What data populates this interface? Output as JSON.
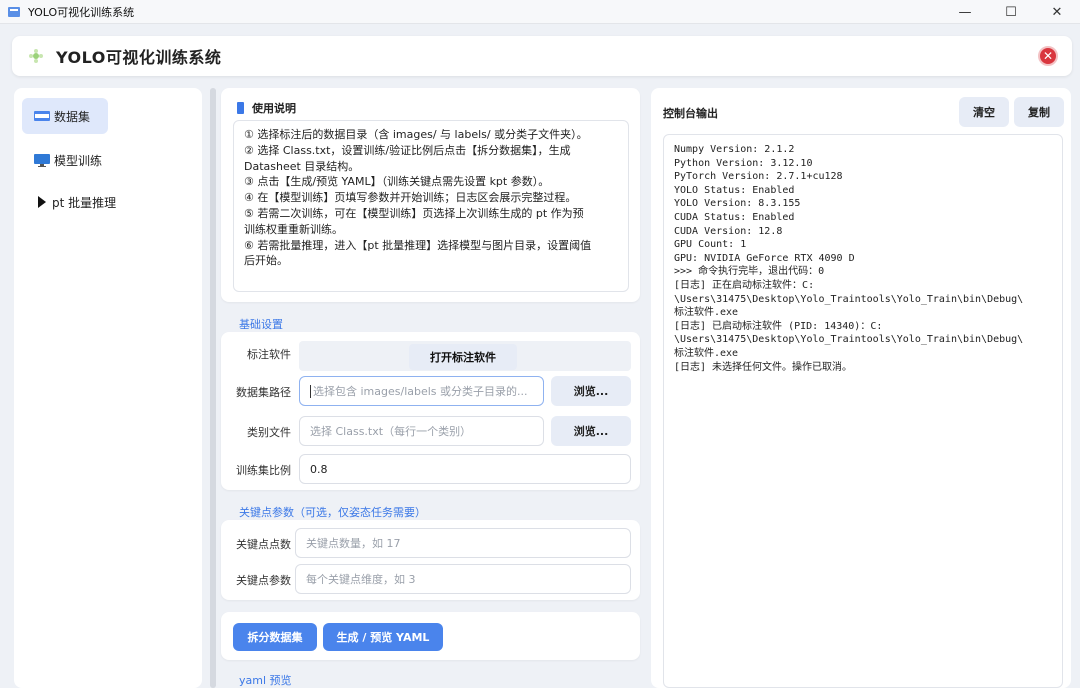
{
  "window": {
    "title": "YOLO可视化训练系统",
    "controls": {
      "minimize": "—",
      "maximize": "☐",
      "close": "✕"
    }
  },
  "header": {
    "title": "YOLO可视化训练系统",
    "close_icon": "✕"
  },
  "sidebar": {
    "items": [
      {
        "label": "数据集",
        "icon": "dataset-icon",
        "active": true
      },
      {
        "label": "模型训练",
        "icon": "monitor-icon",
        "active": false
      },
      {
        "label": "pt 批量推理",
        "icon": "play-triangle-icon",
        "active": false
      }
    ]
  },
  "usage": {
    "title": "使用说明",
    "lines": [
      "① 选择标注后的数据目录（含 images/ 与 labels/ 或分类子文件夹）。",
      "② 选择 Class.txt，设置训练/验证比例后点击【拆分数据集】，生成",
      "Datasheet 目录结构。",
      "③ 点击【生成/预览 YAML】（训练关键点需先设置 kpt 参数）。",
      "④ 在【模型训练】页填写参数并开始训练；日志区会展示完整过程。",
      "⑤ 若需二次训练，可在【模型训练】页选择上次训练生成的 pt 作为预",
      "训练权重重新训练。",
      "⑥ 若需批量推理，进入【pt 批量推理】选择模型与图片目录，设置阈值",
      "后开始。"
    ]
  },
  "basic": {
    "section_label": "基础设置",
    "annot_label": "标注软件",
    "annot_button": "打开标注软件",
    "dataset_label": "数据集路径",
    "dataset_placeholder": "选择包含 images/labels 或分类子目录的...",
    "browse": "浏览...",
    "class_label": "类别文件",
    "class_placeholder": "选择 Class.txt（每行一个类别）",
    "ratio_label": "训练集比例",
    "ratio_value": "0.8"
  },
  "kpt": {
    "section_label": "关键点参数（可选，仅姿态任务需要）",
    "count_label": "关键点点数",
    "count_placeholder": "关键点数量，如 17",
    "dim_label": "关键点参数",
    "dim_placeholder": "每个关键点维度，如 3"
  },
  "actions": {
    "split": "拆分数据集",
    "yaml": "生成 / 预览 YAML"
  },
  "yaml_preview_label": "yaml 预览",
  "console": {
    "title": "控制台输出",
    "clear": "清空",
    "copy": "复制",
    "lines": [
      "Numpy Version: 2.1.2",
      "Python Version: 3.12.10",
      "PyTorch Version: 2.7.1+cu128",
      "YOLO Status: Enabled",
      "YOLO Version: 8.3.155",
      "CUDA Status: Enabled",
      "CUDA Version: 12.8",
      "GPU Count: 1",
      "GPU: NVIDIA GeForce RTX 4090 D",
      ">>> 命令执行完毕，退出代码：0",
      "[日志] 正在启动标注软件：C:",
      "\\Users\\31475\\Desktop\\Yolo_Traintools\\Yolo_Train\\bin\\Debug\\",
      "标注软件.exe",
      "[日志] 已启动标注软件 (PID: 14340)：C:",
      "\\Users\\31475\\Desktop\\Yolo_Traintools\\Yolo_Train\\bin\\Debug\\",
      "标注软件.exe",
      "[日志] 未选择任何文件。操作已取消。"
    ]
  },
  "colors": {
    "accent": "#4a84ec",
    "active_nav": "#dfe8fb",
    "danger": "#d9363e"
  }
}
